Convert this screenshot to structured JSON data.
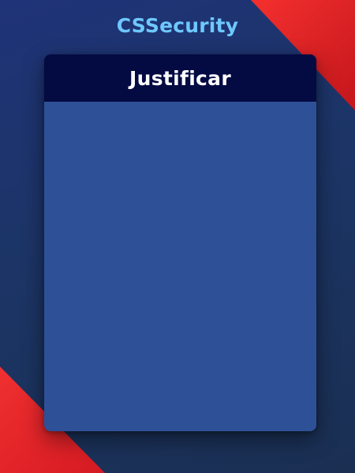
{
  "app": {
    "brand_name": "CSSecurity"
  },
  "card": {
    "title": "Justificar"
  },
  "colors": {
    "background": "#1c3566",
    "accent_red": "#e8242a",
    "brand_text": "#6ec8ff",
    "card_header": "#040a42",
    "card_body": "#2e5096"
  }
}
